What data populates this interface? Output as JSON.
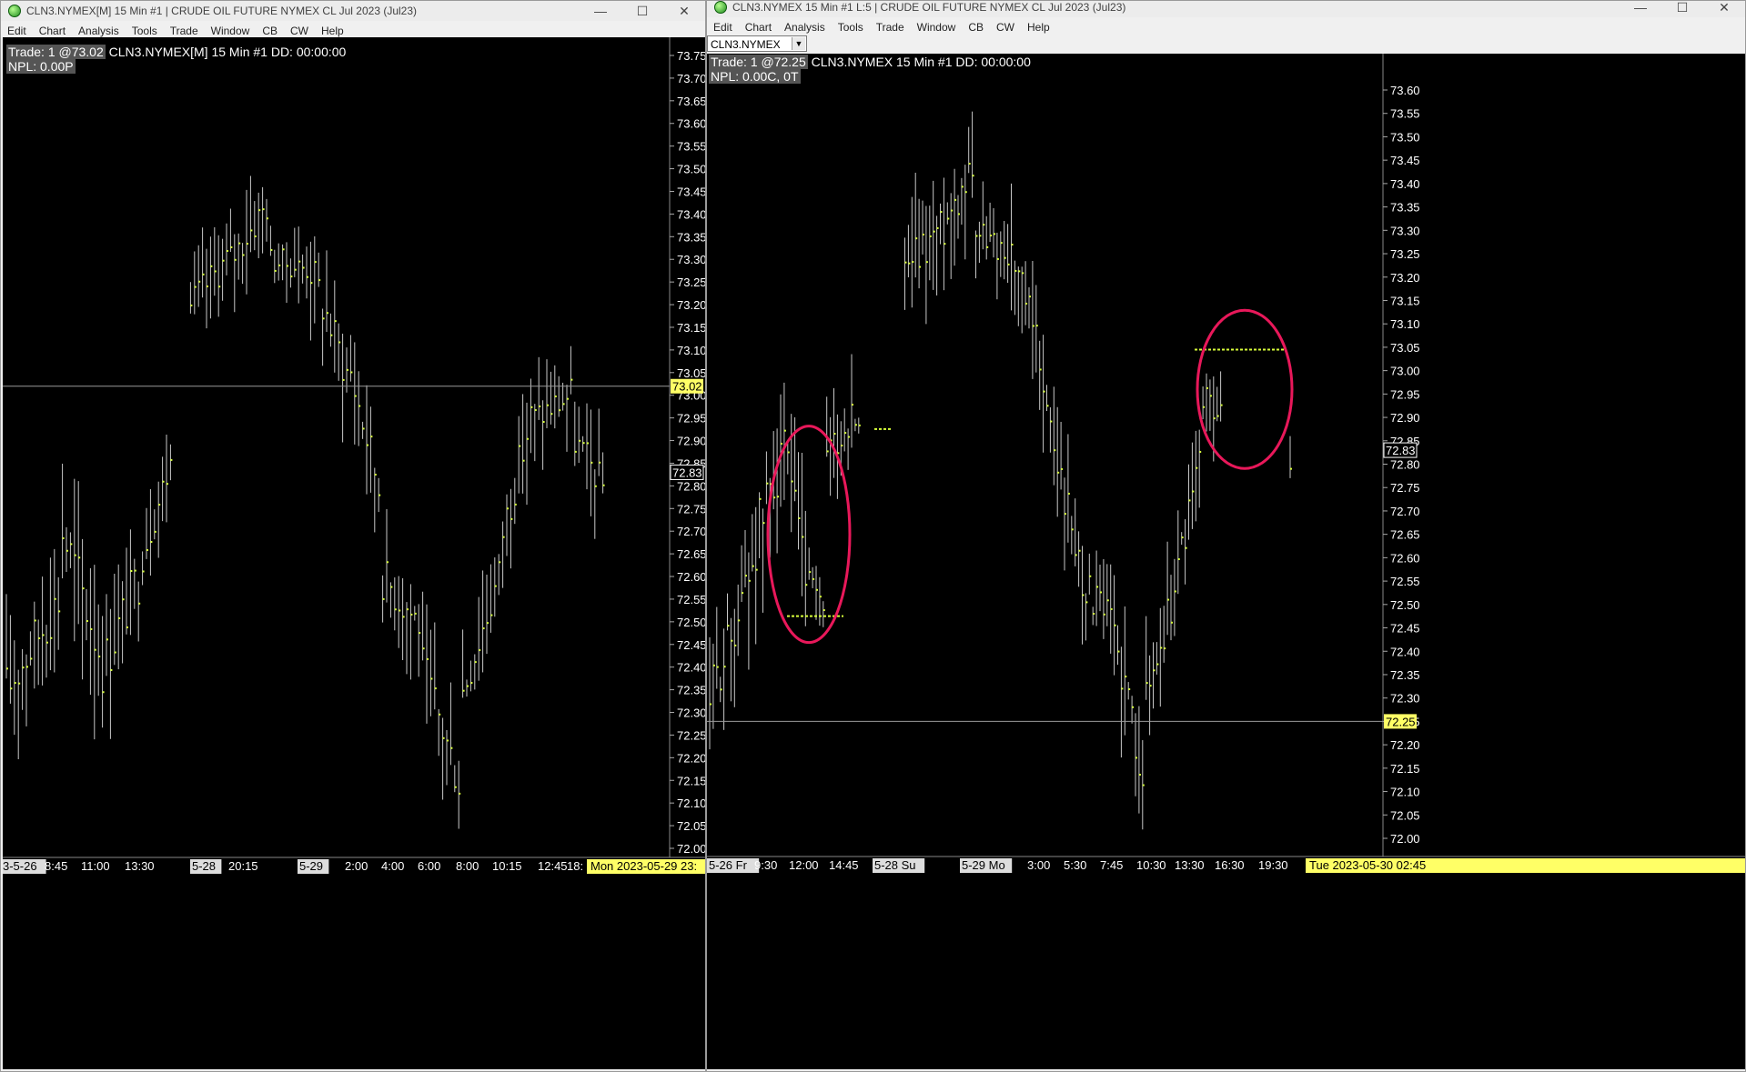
{
  "left": {
    "title": "CLN3.NYMEX[M]  15 Min  #1 | CRUDE OIL FUTURE NYMEX CL Jul 2023 (Jul23)",
    "menu": [
      "Edit",
      "Chart",
      "Analysis",
      "Tools",
      "Trade",
      "Window",
      "CB",
      "CW",
      "Help"
    ],
    "info_line1_hl": "Trade: 1 @73.02",
    "info_line1": " CLN3.NYMEX[M]  15 Min   #1 DD: 00:00:00",
    "info_line2": "NPL: 0.00P",
    "price_ticks": [
      "73.75",
      "73.70",
      "73.65",
      "73.60",
      "73.55",
      "73.50",
      "73.45",
      "73.40",
      "73.35",
      "73.30",
      "73.25",
      "73.20",
      "73.15",
      "73.10",
      "73.05",
      "73.00",
      "72.95",
      "72.90",
      "72.85",
      "72.80",
      "72.75",
      "72.70",
      "72.65",
      "72.60",
      "72.55",
      "72.50",
      "72.45",
      "72.40",
      "72.35",
      "72.30",
      "72.25",
      "72.20",
      "72.15",
      "72.10",
      "72.05",
      "72.00"
    ],
    "trade_price_tag": "73.02",
    "last_price_tag": "72.83",
    "time_labels": [
      "3-5-26",
      "8:45",
      "11:00",
      "13:30",
      "5-28",
      "20:15",
      "5-29",
      "2:00",
      "4:00",
      "6:00",
      "8:00",
      "10:15",
      "12:45",
      "18:"
    ],
    "date_tag": "Mon 2023-05-29  23:",
    "colors": {
      "bar": "#c8c8c8",
      "close_tick": "#d8ff3a",
      "tag_yellow": "#ffff66"
    }
  },
  "right": {
    "title": "CLN3.NYMEX  15 Min  #1 L:5 | CRUDE OIL FUTURE NYMEX CL Jul 2023 (Jul23)",
    "menu": [
      "Edit",
      "Chart",
      "Analysis",
      "Tools",
      "Trade",
      "Window",
      "CB",
      "CW",
      "Help"
    ],
    "symbol": "CLN3.NYMEX",
    "info_line1_hl": "Trade: 1 @72.25",
    "info_line1": " CLN3.NYMEX  15 Min   #1 DD: 00:00:00",
    "info_line2": "NPL: 0.00C, 0T",
    "price_ticks": [
      "73.60",
      "73.55",
      "73.50",
      "73.45",
      "73.40",
      "73.35",
      "73.30",
      "73.25",
      "73.20",
      "73.15",
      "73.10",
      "73.05",
      "73.00",
      "72.95",
      "72.90",
      "72.85",
      "72.80",
      "72.75",
      "72.70",
      "72.65",
      "72.60",
      "72.55",
      "72.50",
      "72.45",
      "72.40",
      "72.35",
      "72.30",
      "72.25",
      "72.20",
      "72.15",
      "72.10",
      "72.05",
      "72.00"
    ],
    "trade_price_tag": "72.25",
    "last_price_tag": "72.83",
    "time_labels": [
      "5-26 Fr",
      "9:30",
      "12:00",
      "14:45",
      "5-28 Su",
      "5-29 Mo",
      "3:00",
      "5:30",
      "7:45",
      "10:30",
      "13:30",
      "16:30",
      "19:30"
    ],
    "date_tag": "Tue 2023-05-30  02:45",
    "colors": {
      "bar": "#c8c8c8",
      "close_tick": "#d8ff3a",
      "tag_yellow": "#ffff66",
      "annotation": "#e8185a"
    }
  }
}
